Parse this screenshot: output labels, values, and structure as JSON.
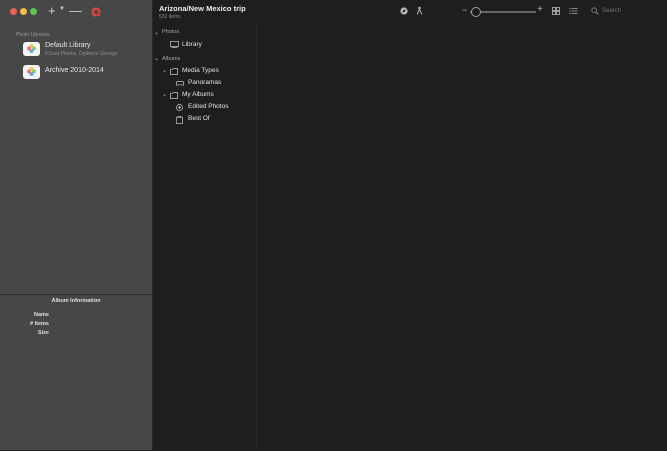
{
  "window": {
    "title": "Arizona/New Mexico trip",
    "subtitle": "532 items"
  },
  "toolbar": {
    "add_label": "+",
    "minus_label": "—",
    "search_placeholder": "Search"
  },
  "libraries": {
    "section_label": "Photo Libraries",
    "items": [
      {
        "name": "Default Library",
        "subtitle": "iCloud Photos, Optimize Storage"
      },
      {
        "name": "Archive 2010-2014",
        "subtitle": ""
      }
    ]
  },
  "album_info": {
    "title": "Album Information",
    "rows": [
      {
        "label": "Name"
      },
      {
        "label": "# Items"
      },
      {
        "label": "Size"
      }
    ]
  },
  "sidebar": {
    "photos_header": "Photos",
    "library": "Library",
    "albums_header": "Albums",
    "media_types": "Media Types",
    "panoramas": "Panoramas",
    "my_albums": "My Albums",
    "edited_photos": "Edited Photos",
    "best_of": "Best Of"
  },
  "colors": {
    "sidebar_bg": "#474747",
    "content_bg": "#1e1e1e",
    "close": "#ee5f57",
    "minimize": "#f4bd4f",
    "zoom": "#5fc454",
    "badge_red": "#e0443e"
  },
  "icons": {
    "close": "close-icon",
    "search": "search-icon",
    "grid": "grid-view-icon",
    "list": "list-view-icon",
    "people": "person-icon",
    "compass": "compass-icon",
    "folder": "folder-icon",
    "panorama": "panorama-icon",
    "edited": "edited-circle-icon",
    "album": "album-icon"
  }
}
